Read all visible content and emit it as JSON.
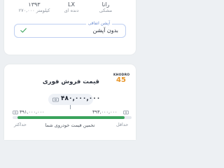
{
  "specs": [
    {
      "value": "رانا",
      "label": "مشکی"
    },
    {
      "value": "LX",
      "label": "دنده ای"
    },
    {
      "value": "۱۳۹۳",
      "label": "۲۷۰,۰۰۰ کیلومتر"
    }
  ],
  "options": {
    "legend": "آپشن اتفاقی",
    "value": "بدون آپشن",
    "icon": "check-icon"
  },
  "price": {
    "title": "قیمت فروش فوری",
    "logo_word": "KHODRO",
    "logo_number": "45",
    "estimate": "۴۸۰,۰۰۰,۰۰۰",
    "min_value": "۳۹۱,۰۰۰,۰۰۰",
    "max_value": "۳۹۳,۰۰۰,۰۰۰",
    "min_label": "حداقل",
    "max_label": "حداکثر",
    "caption": "تخمین قیمت خودروی شما",
    "range_fill_start": 0.04,
    "range_fill_end": 0.94,
    "accent_color": "#3aa35c",
    "currency_icon": "banknote-icon"
  }
}
